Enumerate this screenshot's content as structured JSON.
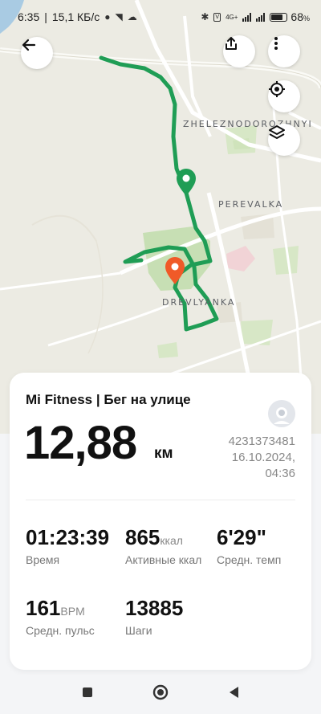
{
  "status": {
    "time": "6:35",
    "speed": "15,1 КБ/с",
    "network": "4G+",
    "battery": "68"
  },
  "map": {
    "labels": {
      "area1": "ZHELEZNODOROZHNYI",
      "area2": "PEREVALKA",
      "area3": "DREVLYANKA"
    },
    "route_color": "#1f9d55",
    "start_color": "#1f9d55",
    "end_color": "#f05a28"
  },
  "toolbar": {
    "back": "back-icon",
    "share": "share-icon",
    "more": "more-icon",
    "locate": "locate-icon",
    "layers": "layers-icon"
  },
  "workout": {
    "title": "Mi Fitness | Бег на улице",
    "distance": "12,88",
    "distance_unit": "км",
    "user_id": "4231373481",
    "date": "16.10.2024,",
    "time": "04:36",
    "stats": [
      {
        "value": "01:23:39",
        "unit": "",
        "label": "Время"
      },
      {
        "value": "865",
        "unit": "ккал",
        "label": "Активные ккал"
      },
      {
        "value": "6'29\"",
        "unit": "",
        "label": "Средн. темп"
      },
      {
        "value": "161",
        "unit": "BPM",
        "label": "Средн. пульс"
      },
      {
        "value": "13885",
        "unit": "",
        "label": "Шаги"
      }
    ]
  },
  "navbar": {
    "recents": "square-icon",
    "home": "circle-icon",
    "back": "triangle-back-icon"
  }
}
